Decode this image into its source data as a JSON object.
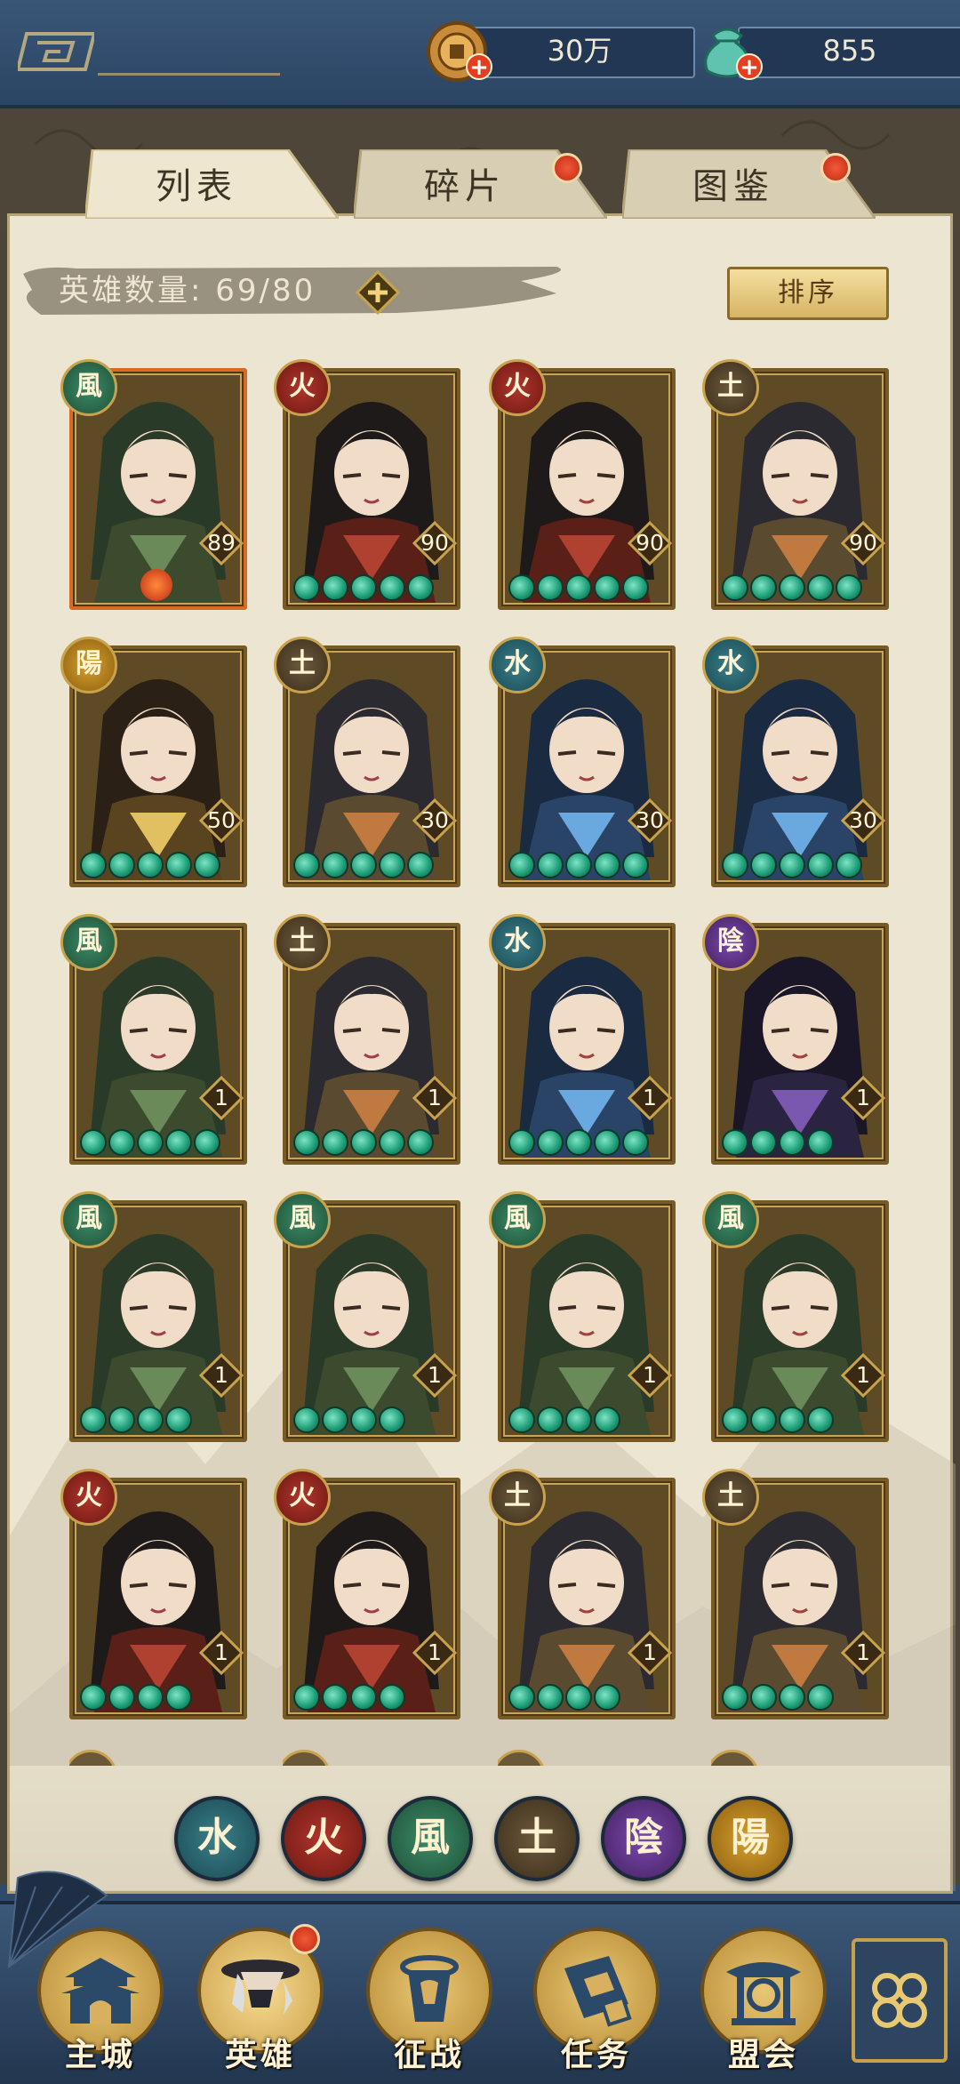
{
  "topbar": {
    "coins": "30万",
    "jade": "855",
    "coin_icon": "coin-icon",
    "jade_icon": "jade-pouch-icon"
  },
  "tabs": [
    {
      "label": "列表",
      "active": true,
      "badge": false
    },
    {
      "label": "碎片",
      "active": false,
      "badge": true
    },
    {
      "label": "图鉴",
      "active": false,
      "badge": true
    }
  ],
  "hero_count": {
    "label": "英雄数量:",
    "value": "69/80"
  },
  "sort_label": "排序",
  "heroes": [
    {
      "element": "wind",
      "glyph": "風",
      "level": "89",
      "stars": 0,
      "special": "fire"
    },
    {
      "element": "fire",
      "glyph": "火",
      "level": "90",
      "stars": 5
    },
    {
      "element": "fire",
      "glyph": "火",
      "level": "90",
      "stars": 5
    },
    {
      "element": "earth",
      "glyph": "土",
      "level": "90",
      "stars": 5
    },
    {
      "element": "yang",
      "glyph": "陽",
      "level": "50",
      "stars": 5
    },
    {
      "element": "earth",
      "glyph": "土",
      "level": "30",
      "stars": 5
    },
    {
      "element": "water",
      "glyph": "水",
      "level": "30",
      "stars": 5
    },
    {
      "element": "water",
      "glyph": "水",
      "level": "30",
      "stars": 5
    },
    {
      "element": "wind",
      "glyph": "風",
      "level": "1",
      "stars": 5
    },
    {
      "element": "earth",
      "glyph": "土",
      "level": "1",
      "stars": 5
    },
    {
      "element": "water",
      "glyph": "水",
      "level": "1",
      "stars": 5
    },
    {
      "element": "yin",
      "glyph": "陰",
      "level": "1",
      "stars": 4
    },
    {
      "element": "wind",
      "glyph": "風",
      "level": "1",
      "stars": 4
    },
    {
      "element": "wind",
      "glyph": "風",
      "level": "1",
      "stars": 4
    },
    {
      "element": "wind",
      "glyph": "風",
      "level": "1",
      "stars": 4
    },
    {
      "element": "wind",
      "glyph": "風",
      "level": "1",
      "stars": 4
    },
    {
      "element": "fire",
      "glyph": "火",
      "level": "1",
      "stars": 4
    },
    {
      "element": "fire",
      "glyph": "火",
      "level": "1",
      "stars": 4
    },
    {
      "element": "earth",
      "glyph": "土",
      "level": "1",
      "stars": 4
    },
    {
      "element": "earth",
      "glyph": "土",
      "level": "1",
      "stars": 4
    }
  ],
  "filters": [
    {
      "element": "water",
      "glyph": "水"
    },
    {
      "element": "fire",
      "glyph": "火"
    },
    {
      "element": "wind",
      "glyph": "風"
    },
    {
      "element": "earth",
      "glyph": "土"
    },
    {
      "element": "yin",
      "glyph": "陰"
    },
    {
      "element": "yang",
      "glyph": "陽"
    }
  ],
  "nav": [
    {
      "label": "主城",
      "icon": "city-gate-icon",
      "badge": false
    },
    {
      "label": "英雄",
      "icon": "hero-portrait-icon",
      "badge": true
    },
    {
      "label": "征战",
      "icon": "battle-banner-icon",
      "badge": false
    },
    {
      "label": "任务",
      "icon": "scroll-quest-icon",
      "badge": false
    },
    {
      "label": "盟会",
      "icon": "alliance-pavilion-icon",
      "badge": false
    }
  ],
  "more_icon": "clover-menu-icon",
  "colors": {
    "panel_bg": "#ece5d1",
    "frame_blue": "#2f4a6a",
    "gold": "#c9a24e",
    "star_green": "#1a9a74"
  }
}
